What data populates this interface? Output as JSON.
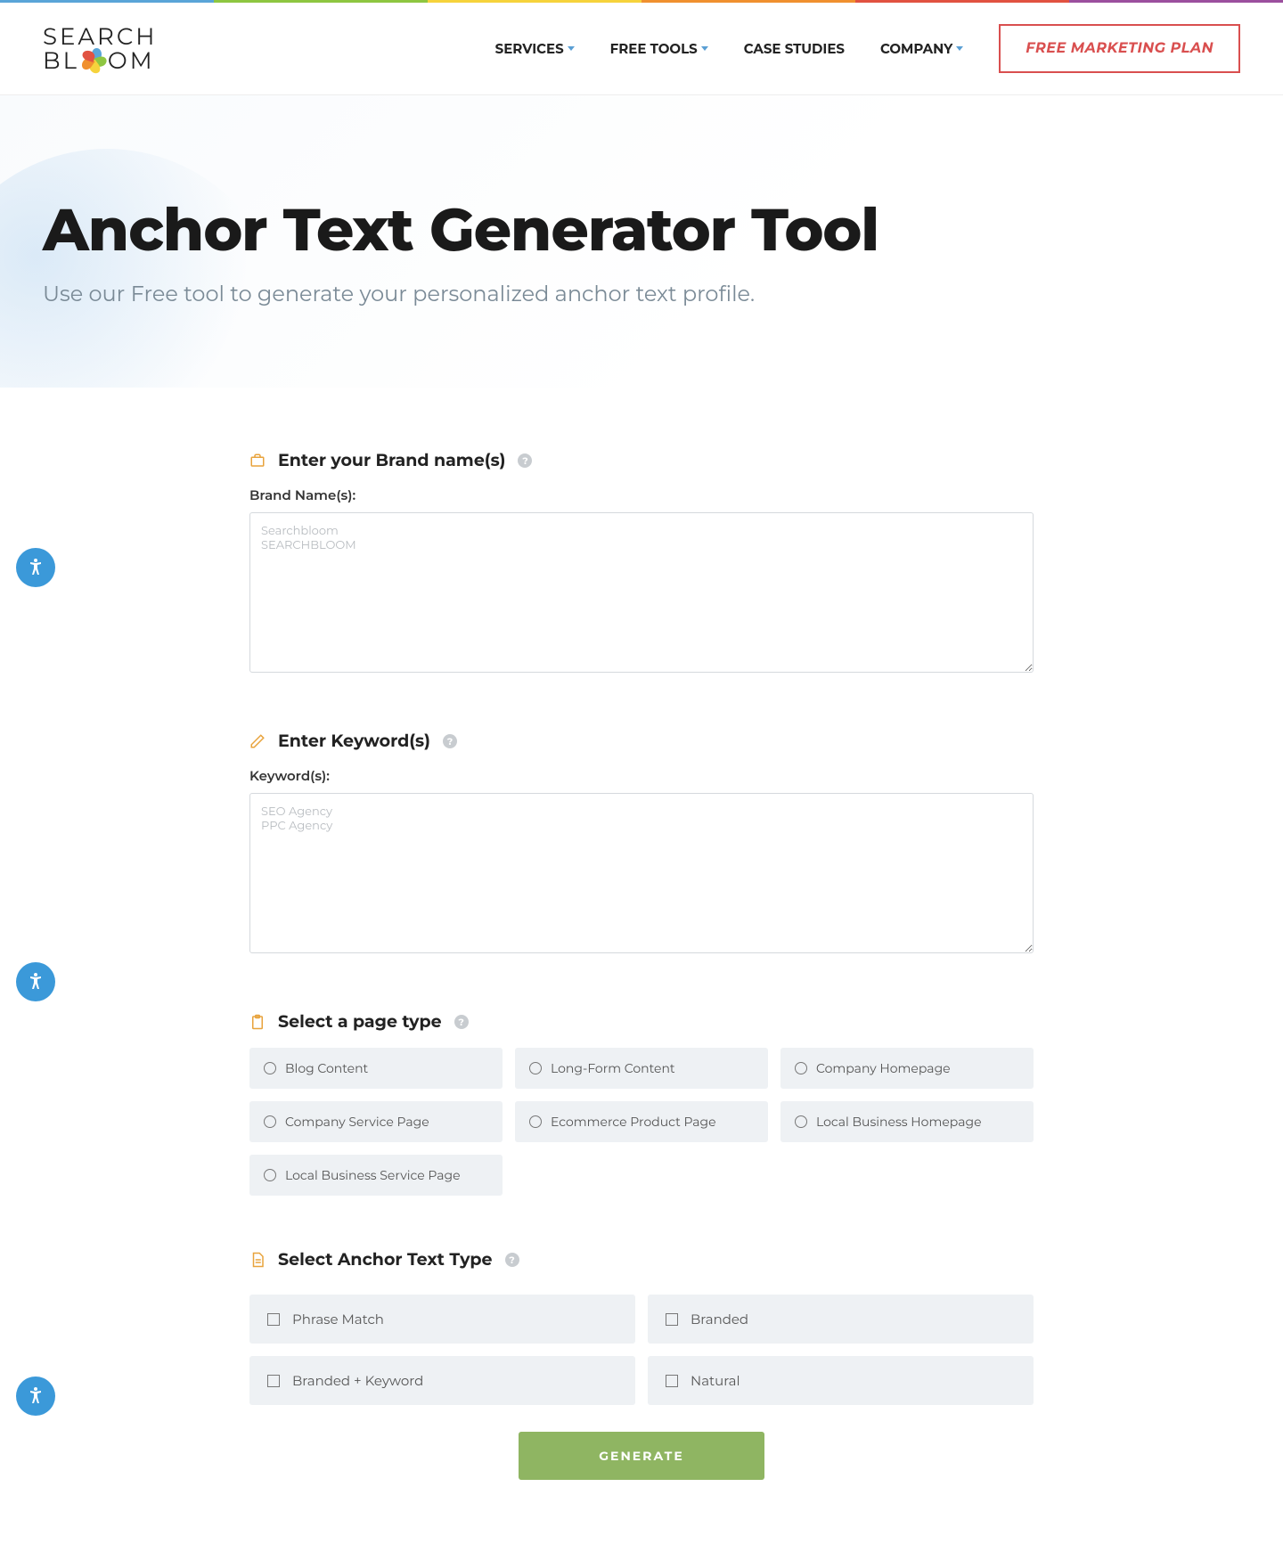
{
  "rainbow": [
    "#5aa5d8",
    "#8ec641",
    "#f6d33c",
    "#f0902f",
    "#e15241",
    "#9b4f9e"
  ],
  "logo": {
    "top": "SEARCH",
    "bottom_left": "BL",
    "bottom_right": "OM"
  },
  "nav": {
    "services": "SERVICES",
    "tools": "FREE TOOLS",
    "case": "CASE STUDIES",
    "company": "COMPANY"
  },
  "cta": "FREE MARKETING PLAN",
  "hero": {
    "title": "Anchor Text Generator Tool",
    "subtitle": "Use our Free tool to generate your personalized anchor text profile."
  },
  "brand": {
    "heading": "Enter your Brand name(s)",
    "label": "Brand Name(s):",
    "placeholder": "Searchbloom\nSEARCHBLOOM"
  },
  "keywords": {
    "heading": "Enter Keyword(s)",
    "label": "Keyword(s):",
    "placeholder": "SEO Agency\nPPC Agency"
  },
  "pagetype": {
    "heading": "Select a page type",
    "options": [
      "Blog Content",
      "Long-Form Content",
      "Company Homepage",
      "Company Service Page",
      "Ecommerce Product Page",
      "Local Business Homepage",
      "Local Business Service Page"
    ]
  },
  "anchor": {
    "heading": "Select Anchor Text Type",
    "options": [
      "Phrase Match",
      "Branded",
      "Branded + Keyword",
      "Natural"
    ]
  },
  "generate": "GENERATE"
}
